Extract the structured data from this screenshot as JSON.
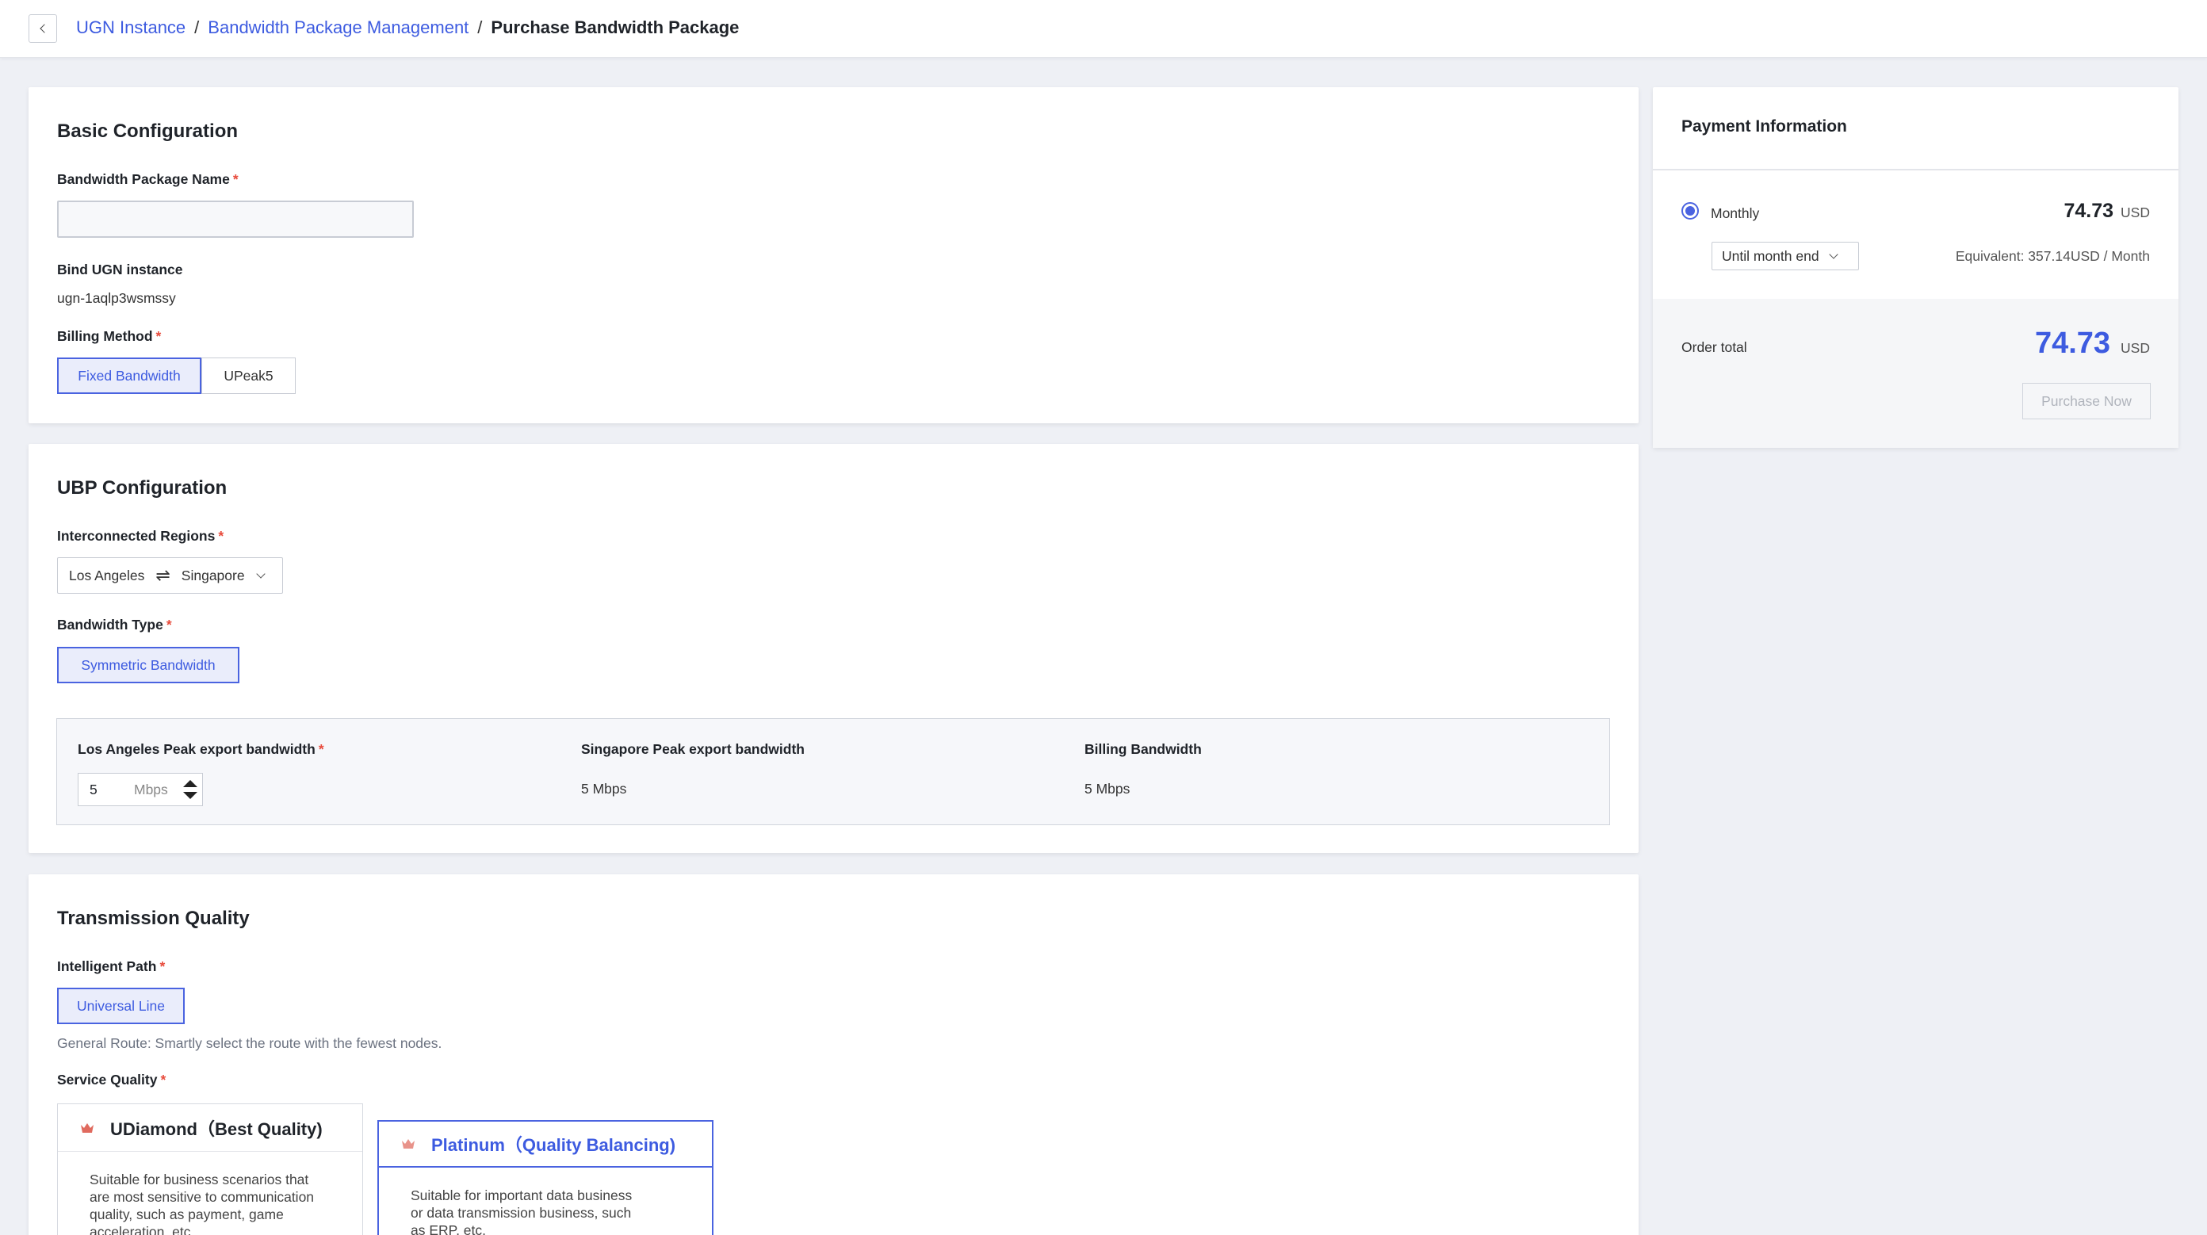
{
  "breadcrumb": {
    "items": [
      "UGN Instance",
      "Bandwidth Package Management"
    ],
    "separator": "/",
    "current": "Purchase Bandwidth Package"
  },
  "basic": {
    "title": "Basic Configuration",
    "name_label": "Bandwidth Package Name",
    "name_value": "",
    "bind_label": "Bind UGN instance",
    "bind_value": "ugn-1aqlp3wsmssy",
    "billing_label": "Billing Method",
    "billing_options": [
      "Fixed Bandwidth",
      "UPeak5"
    ],
    "billing_selected": "Fixed Bandwidth"
  },
  "ubp": {
    "title": "UBP Configuration",
    "regions_label": "Interconnected Regions",
    "region_a": "Los Angeles",
    "region_b": "Singapore",
    "swap_glyph": "⇌",
    "type_label": "Bandwidth Type",
    "type_option": "Symmetric Bandwidth",
    "la_peak_label": "Los Angeles Peak export bandwidth",
    "la_peak_value": "5",
    "la_peak_unit": "Mbps",
    "sg_peak_label": "Singapore Peak export bandwidth",
    "sg_peak_value": "5 Mbps",
    "billing_bw_label": "Billing Bandwidth",
    "billing_bw_value": "5 Mbps"
  },
  "transmission": {
    "title": "Transmission Quality",
    "path_label": "Intelligent Path",
    "path_option": "Universal Line",
    "path_hint": "General Route: Smartly select the route with the fewest nodes.",
    "quality_label": "Service Quality",
    "qualities": [
      {
        "name": "UDiamond（Best Quality)",
        "desc": "Suitable for business scenarios that are most sensitive to communication quality, such as payment, game acceleration, etc."
      },
      {
        "name": "Platinum（Quality Balancing)",
        "desc": "Suitable for important data business or data transmission business, such as ERP, etc."
      }
    ]
  },
  "payment": {
    "title": "Payment Information",
    "plan": "Monthly",
    "price": "74.73",
    "currency": "USD",
    "duration": "Until month end",
    "equivalent": "Equivalent: 357.14USD / Month",
    "order_total_label": "Order total",
    "order_total": "74.73",
    "purchase_label": "Purchase Now"
  },
  "colors": {
    "accent": "#3d5be0",
    "required": "#e84b3c",
    "background": "#eef0f5",
    "crown": "#e06a5e"
  },
  "icons": {
    "back": "chevron-left-icon",
    "dropdown": "chevron-down-icon",
    "swap": "swap-arrows-icon",
    "crown": "crown-icon",
    "stepper": "stepper-arrows-icon"
  }
}
